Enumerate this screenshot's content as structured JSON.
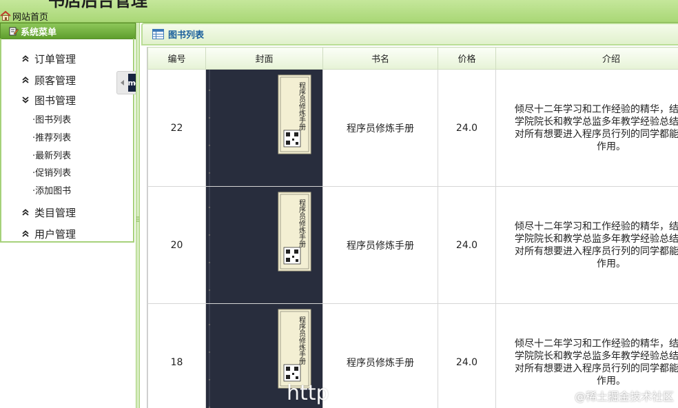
{
  "header": {
    "app_title": "书店后台管理",
    "home_link": "网站首页"
  },
  "sidebar": {
    "title": "系统菜单",
    "groups": [
      {
        "label": "订单管理",
        "expanded": false
      },
      {
        "label": "顾客管理",
        "expanded": false
      },
      {
        "label": "图书管理",
        "expanded": true
      },
      {
        "label": "类目管理",
        "expanded": false
      },
      {
        "label": "用户管理",
        "expanded": false
      }
    ],
    "book_items": [
      "·图书列表",
      "·推荐列表",
      "·最新列表",
      "·促销列表",
      "·添加图书"
    ],
    "collapse_badge": "mo"
  },
  "main": {
    "panel_title": "图书列表",
    "columns": [
      "编号",
      "封面",
      "书名",
      "价格",
      "介绍"
    ],
    "rows": [
      {
        "id": "22",
        "cover_text": "程序员修炼手册",
        "title": "程序员修炼手册",
        "price": "24.0",
        "intro": [
          "倾尽十二年学习和工作经验的精华，结合北京",
          "学院院长和教学总监多年教学经验总结，特著",
          "对所有想要进入程序员行列的同学都能起到一",
          "作用。"
        ]
      },
      {
        "id": "20",
        "cover_text": "程序员修炼手册",
        "title": "程序员修炼手册",
        "price": "24.0",
        "intro": [
          "倾尽十二年学习和工作经验的精华，结合北京",
          "学院院长和教学总监多年教学经验总结，特著",
          "对所有想要进入程序员行列的同学都能起到一",
          "作用。"
        ]
      },
      {
        "id": "18",
        "cover_text": "程序员修炼手册",
        "title": "程序员修炼手册",
        "price": "24.0",
        "intro": [
          "倾尽十二年学习和工作经验的精华，结合北京",
          "学院院长和教学总监多年教学经验总结，特著",
          "对所有想要进入程序员行列的同学都能起到一",
          "作用。"
        ]
      }
    ]
  },
  "watermark": {
    "url": "http",
    "site": "@稀土掘金技术社区"
  },
  "colors": {
    "header_green": "#a9d776",
    "sidebar_head": "#5f9e2d",
    "panel_title": "#1a5f9c",
    "book_title": "#2e6d3a",
    "cover_dark": "#282d3d"
  }
}
